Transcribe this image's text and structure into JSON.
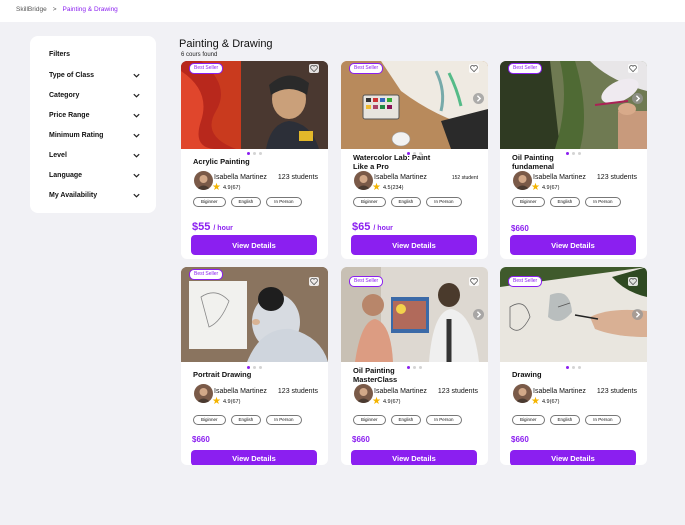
{
  "breadcrumb": {
    "home": "SkillBridge",
    "separator": ">",
    "current": "Painting & Drawing"
  },
  "filters": {
    "title": "Filters",
    "items": [
      "Type of Class",
      "Category",
      "Price Range",
      "Minimum Rating",
      "Level",
      "Language",
      "My Availability"
    ]
  },
  "page": {
    "title": "Painting & Drawing",
    "result_count": "6 cours found"
  },
  "colors": {
    "accent": "#8b1ff0",
    "star": "#f4b400",
    "background": "#f1f1f5"
  },
  "cards": [
    {
      "badge": "Best Seller",
      "title": "Acrylic Painting",
      "tutor": "Isabella Martinez",
      "students": "123 students",
      "rating": "4.9(67)",
      "tags": [
        "Biginner",
        "English",
        "In Person"
      ],
      "price": "$55",
      "price_unit": "/ hour",
      "cta": "View Details"
    },
    {
      "badge": "Best Seller",
      "title": "Watercolor Lab: Paint Like a Pro",
      "tutor": "Isabella Martinez",
      "students": "152 student",
      "rating": "4.5(234)",
      "tags": [
        "Biginner",
        "English",
        "In Person"
      ],
      "price": "$65",
      "price_unit": "/ hour",
      "cta": "View Details"
    },
    {
      "badge": "Best Seller",
      "title": "Oil Painting fundamenal",
      "tutor": "Isabella Martinez",
      "students": "123 students",
      "rating": "4.9(67)",
      "tags": [
        "Biginner",
        "English",
        "In Person"
      ],
      "price": "$660",
      "price_unit": "",
      "cta": "View Details"
    },
    {
      "badge": "Best Seller",
      "title": "Portrait Drawing",
      "tutor": "Isabella Martinez",
      "students": "123 students",
      "rating": "4.9(67)",
      "tags": [
        "Biginner",
        "English",
        "In Person"
      ],
      "price": "$660",
      "price_unit": "",
      "cta": "View Details"
    },
    {
      "badge": "Best Seller",
      "title": "Oil Painting MasterClass",
      "tutor": "Isabella Martinez",
      "students": "123 students",
      "rating": "4.9(67)",
      "tags": [
        "Biginner",
        "English",
        "In Person"
      ],
      "price": "$660",
      "price_unit": "",
      "cta": "View Details"
    },
    {
      "badge": "Best Seller",
      "title": "Drawing",
      "tutor": "Isabella Martinez",
      "students": "123 students",
      "rating": "4.9(67)",
      "tags": [
        "Biginner",
        "English",
        "In Person"
      ],
      "price": "$660",
      "price_unit": "",
      "cta": "View Details"
    }
  ]
}
